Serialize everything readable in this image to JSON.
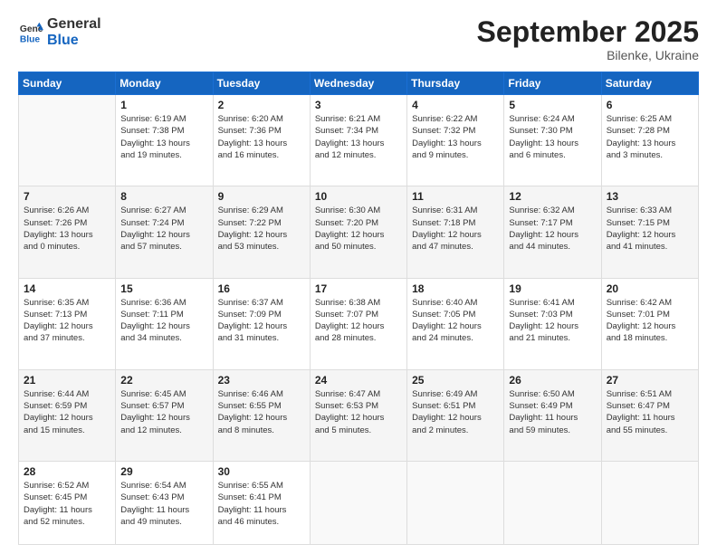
{
  "header": {
    "logo_line1": "General",
    "logo_line2": "Blue",
    "month": "September 2025",
    "location": "Bilenke, Ukraine"
  },
  "weekdays": [
    "Sunday",
    "Monday",
    "Tuesday",
    "Wednesday",
    "Thursday",
    "Friday",
    "Saturday"
  ],
  "weeks": [
    [
      {
        "day": "",
        "info": ""
      },
      {
        "day": "1",
        "info": "Sunrise: 6:19 AM\nSunset: 7:38 PM\nDaylight: 13 hours\nand 19 minutes."
      },
      {
        "day": "2",
        "info": "Sunrise: 6:20 AM\nSunset: 7:36 PM\nDaylight: 13 hours\nand 16 minutes."
      },
      {
        "day": "3",
        "info": "Sunrise: 6:21 AM\nSunset: 7:34 PM\nDaylight: 13 hours\nand 12 minutes."
      },
      {
        "day": "4",
        "info": "Sunrise: 6:22 AM\nSunset: 7:32 PM\nDaylight: 13 hours\nand 9 minutes."
      },
      {
        "day": "5",
        "info": "Sunrise: 6:24 AM\nSunset: 7:30 PM\nDaylight: 13 hours\nand 6 minutes."
      },
      {
        "day": "6",
        "info": "Sunrise: 6:25 AM\nSunset: 7:28 PM\nDaylight: 13 hours\nand 3 minutes."
      }
    ],
    [
      {
        "day": "7",
        "info": "Sunrise: 6:26 AM\nSunset: 7:26 PM\nDaylight: 13 hours\nand 0 minutes."
      },
      {
        "day": "8",
        "info": "Sunrise: 6:27 AM\nSunset: 7:24 PM\nDaylight: 12 hours\nand 57 minutes."
      },
      {
        "day": "9",
        "info": "Sunrise: 6:29 AM\nSunset: 7:22 PM\nDaylight: 12 hours\nand 53 minutes."
      },
      {
        "day": "10",
        "info": "Sunrise: 6:30 AM\nSunset: 7:20 PM\nDaylight: 12 hours\nand 50 minutes."
      },
      {
        "day": "11",
        "info": "Sunrise: 6:31 AM\nSunset: 7:18 PM\nDaylight: 12 hours\nand 47 minutes."
      },
      {
        "day": "12",
        "info": "Sunrise: 6:32 AM\nSunset: 7:17 PM\nDaylight: 12 hours\nand 44 minutes."
      },
      {
        "day": "13",
        "info": "Sunrise: 6:33 AM\nSunset: 7:15 PM\nDaylight: 12 hours\nand 41 minutes."
      }
    ],
    [
      {
        "day": "14",
        "info": "Sunrise: 6:35 AM\nSunset: 7:13 PM\nDaylight: 12 hours\nand 37 minutes."
      },
      {
        "day": "15",
        "info": "Sunrise: 6:36 AM\nSunset: 7:11 PM\nDaylight: 12 hours\nand 34 minutes."
      },
      {
        "day": "16",
        "info": "Sunrise: 6:37 AM\nSunset: 7:09 PM\nDaylight: 12 hours\nand 31 minutes."
      },
      {
        "day": "17",
        "info": "Sunrise: 6:38 AM\nSunset: 7:07 PM\nDaylight: 12 hours\nand 28 minutes."
      },
      {
        "day": "18",
        "info": "Sunrise: 6:40 AM\nSunset: 7:05 PM\nDaylight: 12 hours\nand 24 minutes."
      },
      {
        "day": "19",
        "info": "Sunrise: 6:41 AM\nSunset: 7:03 PM\nDaylight: 12 hours\nand 21 minutes."
      },
      {
        "day": "20",
        "info": "Sunrise: 6:42 AM\nSunset: 7:01 PM\nDaylight: 12 hours\nand 18 minutes."
      }
    ],
    [
      {
        "day": "21",
        "info": "Sunrise: 6:44 AM\nSunset: 6:59 PM\nDaylight: 12 hours\nand 15 minutes."
      },
      {
        "day": "22",
        "info": "Sunrise: 6:45 AM\nSunset: 6:57 PM\nDaylight: 12 hours\nand 12 minutes."
      },
      {
        "day": "23",
        "info": "Sunrise: 6:46 AM\nSunset: 6:55 PM\nDaylight: 12 hours\nand 8 minutes."
      },
      {
        "day": "24",
        "info": "Sunrise: 6:47 AM\nSunset: 6:53 PM\nDaylight: 12 hours\nand 5 minutes."
      },
      {
        "day": "25",
        "info": "Sunrise: 6:49 AM\nSunset: 6:51 PM\nDaylight: 12 hours\nand 2 minutes."
      },
      {
        "day": "26",
        "info": "Sunrise: 6:50 AM\nSunset: 6:49 PM\nDaylight: 11 hours\nand 59 minutes."
      },
      {
        "day": "27",
        "info": "Sunrise: 6:51 AM\nSunset: 6:47 PM\nDaylight: 11 hours\nand 55 minutes."
      }
    ],
    [
      {
        "day": "28",
        "info": "Sunrise: 6:52 AM\nSunset: 6:45 PM\nDaylight: 11 hours\nand 52 minutes."
      },
      {
        "day": "29",
        "info": "Sunrise: 6:54 AM\nSunset: 6:43 PM\nDaylight: 11 hours\nand 49 minutes."
      },
      {
        "day": "30",
        "info": "Sunrise: 6:55 AM\nSunset: 6:41 PM\nDaylight: 11 hours\nand 46 minutes."
      },
      {
        "day": "",
        "info": ""
      },
      {
        "day": "",
        "info": ""
      },
      {
        "day": "",
        "info": ""
      },
      {
        "day": "",
        "info": ""
      }
    ]
  ]
}
